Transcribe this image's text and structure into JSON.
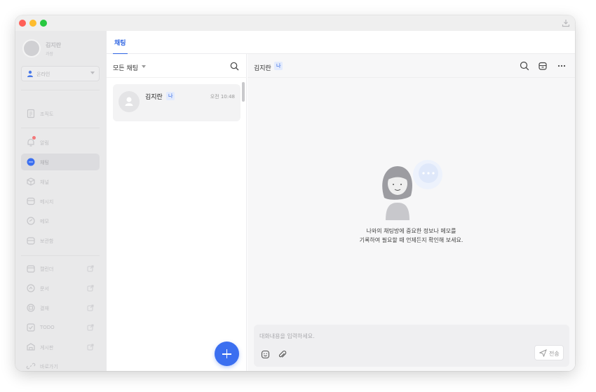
{
  "profile": {
    "name": "김지란",
    "role": "과장"
  },
  "status": {
    "label": "온라인"
  },
  "sidebar": {
    "items": [
      {
        "label": "조직도"
      },
      {
        "label": "알림"
      },
      {
        "label": "채팅"
      },
      {
        "label": "채널"
      },
      {
        "label": "메시지"
      },
      {
        "label": "메모"
      },
      {
        "label": "보관함"
      },
      {
        "label": "캘린더"
      },
      {
        "label": "문서"
      },
      {
        "label": "결재"
      },
      {
        "label": "TODO"
      },
      {
        "label": "게시판"
      },
      {
        "label": "바로가기"
      }
    ]
  },
  "tabs": {
    "active": "채팅"
  },
  "list": {
    "filter": "모든 채팅",
    "items": [
      {
        "name": "김지란",
        "badge": "나",
        "time": "오전 10:48"
      }
    ]
  },
  "chat": {
    "header_name": "김지란",
    "header_badge": "나",
    "empty_line1": "나와의 채팅방에 중요한 정보나 메모를",
    "empty_line2": "기록하여 필요할 때 언제든지 확인해 보세요.",
    "composer_placeholder": "대화내용을 입력하세요.",
    "send_label": "전송"
  },
  "colors": {
    "accent": "#2d63e2",
    "fab": "#3b6ff0",
    "badge_bg": "#e3ebfd",
    "notice_dot": "#f3787a"
  }
}
